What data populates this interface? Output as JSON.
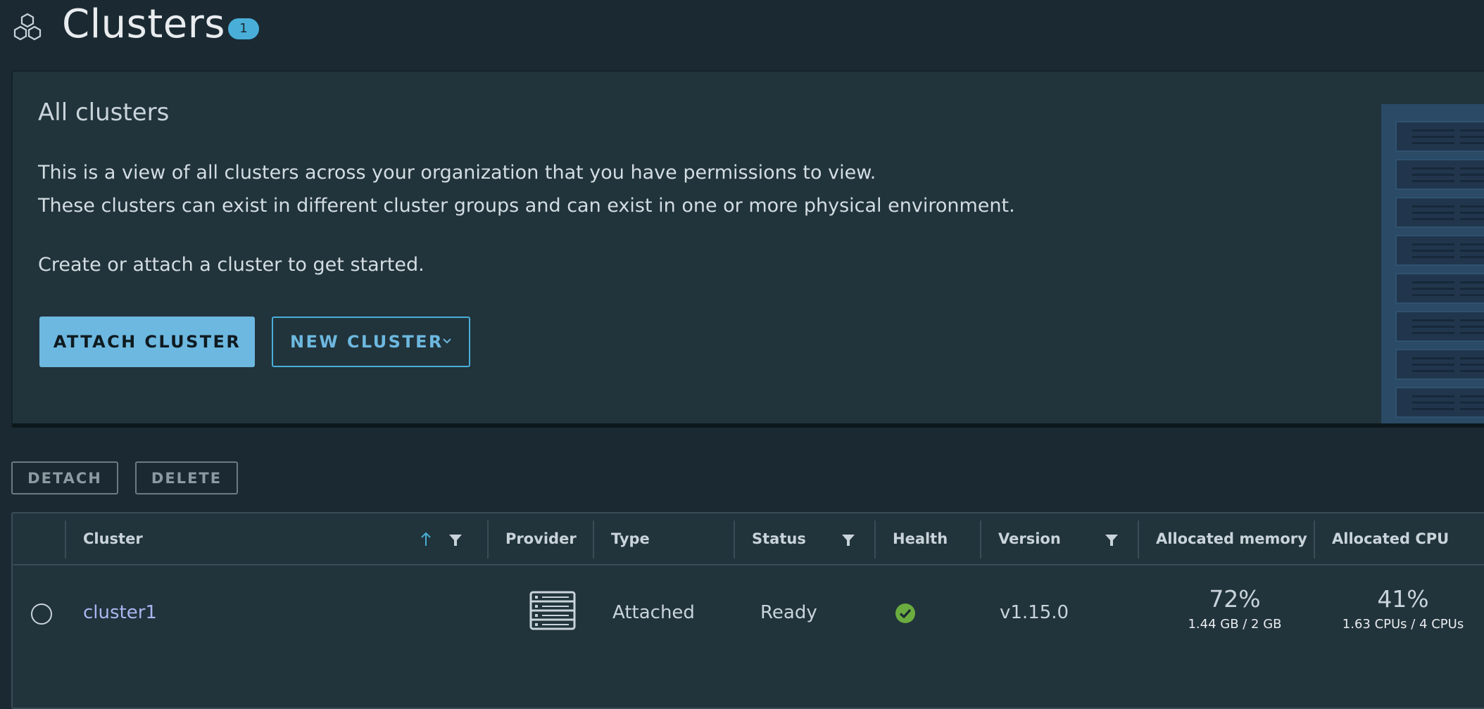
{
  "header": {
    "icon": "clusters-hexagon-icon",
    "title": "Clusters",
    "count": "1"
  },
  "intro": {
    "title": "All clusters",
    "line1": "This is a view of all clusters across your organization that you have permissions to view.",
    "line2": "These clusters can exist in different cluster groups and can exist in one or more physical environment.",
    "line3": "Create or attach a cluster to get started.",
    "attach_label": "ATTACH CLUSTER",
    "new_label": "NEW CLUSTER"
  },
  "actions": {
    "detach_label": "DETACH",
    "delete_label": "DELETE"
  },
  "grid": {
    "columns": [
      "Cluster",
      "Provider",
      "Type",
      "Status",
      "Health",
      "Version",
      "Allocated memory",
      "Allocated CPU"
    ],
    "rows": [
      {
        "cluster": "cluster1",
        "provider_icon": "server-rack-icon",
        "type": "Attached",
        "status": "Ready",
        "health_icon": "check-circle-icon",
        "version": "v1.15.0",
        "memory_pct": "72%",
        "memory_detail": "1.44 GB / 2 GB",
        "cpu_pct": "41%",
        "cpu_detail": "1.63 CPUs / 4 CPUs"
      }
    ]
  },
  "colors": {
    "accent": "#49afd9",
    "background": "#1b2a32",
    "card": "#21333b",
    "health_ok": "#6aac3f"
  }
}
